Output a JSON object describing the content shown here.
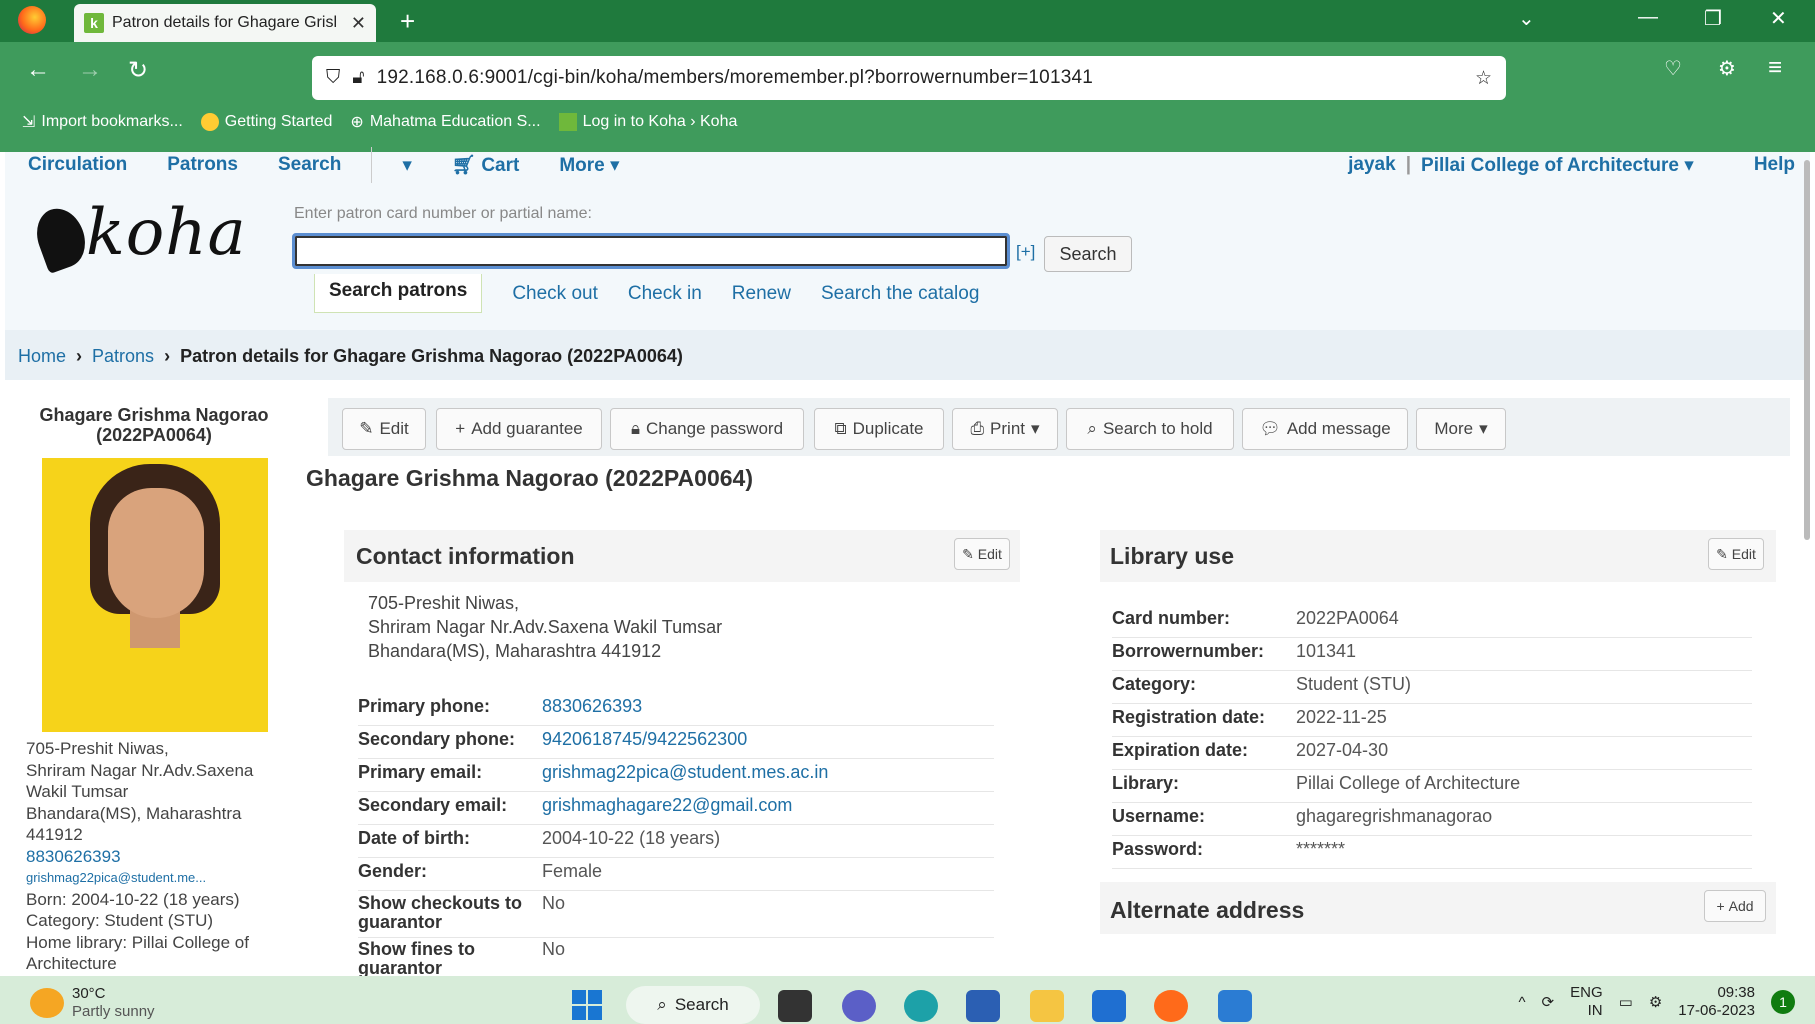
{
  "browser": {
    "tab_title": "Patron details for Ghagare Grisl",
    "url": "192.168.0.6:9001/cgi-bin/koha/members/moremember.pl?borrowernumber=101341",
    "bookmarks": [
      "Import bookmarks...",
      "Getting Started",
      "Mahatma Education S...",
      "Log in to Koha › Koha"
    ]
  },
  "koha_nav": {
    "items": [
      "Circulation",
      "Patrons",
      "Search",
      "Cart",
      "More"
    ],
    "user": "jayak",
    "library": "Pillai College of Architecture",
    "help": "Help"
  },
  "logo_text": "koha",
  "patron_search": {
    "label": "Enter patron card number or partial name:",
    "value": "",
    "plus": "[+]",
    "button": "Search"
  },
  "sub_tabs": [
    "Search patrons",
    "Check out",
    "Check in",
    "Renew",
    "Search the catalog"
  ],
  "breadcrumb": {
    "home": "Home",
    "patrons": "Patrons",
    "current": "Patron details for Ghagare Grishma Nagorao (2022PA0064)"
  },
  "sidebar": {
    "name": "Ghagare Grishma Nagorao (2022PA0064)",
    "address": [
      "705-Preshit Niwas,",
      "Shriram Nagar Nr.Adv.Saxena",
      "Wakil Tumsar",
      "Bhandara(MS), Maharashtra",
      "441912"
    ],
    "phone": "8830626393",
    "email": "grishmag22pica@student.me...",
    "born": "Born: 2004-10-22 (18 years)",
    "category": "Category: Student (STU)",
    "home_library": [
      "Home library: Pillai College of",
      "Architecture"
    ]
  },
  "toolbar": [
    "Edit",
    "Add guarantee",
    "Change password",
    "Duplicate",
    "Print",
    "Search to hold",
    "Add message",
    "More"
  ],
  "patron_title": "Ghagare Grishma Nagorao (2022PA0064)",
  "contact": {
    "title": "Contact information",
    "edit": "Edit",
    "address": [
      "705-Preshit Niwas,",
      "Shriram Nagar Nr.Adv.Saxena Wakil Tumsar",
      "Bhandara(MS), Maharashtra 441912"
    ],
    "rows": [
      {
        "label": "Primary phone:",
        "value": "8830626393"
      },
      {
        "label": "Secondary phone:",
        "value": "9420618745/9422562300"
      },
      {
        "label": "Primary email:",
        "value": "grishmag22pica@student.mes.ac.in"
      },
      {
        "label": "Secondary email:",
        "value": "grishmaghagare22@gmail.com"
      },
      {
        "label": "Date of birth:",
        "value": "2004-10-22 (18 years)"
      },
      {
        "label": "Gender:",
        "value": "Female"
      },
      {
        "label": "Show checkouts to guarantor",
        "value": "No"
      },
      {
        "label": "Show fines to guarantor",
        "value": "No"
      }
    ]
  },
  "library_use": {
    "title": "Library use",
    "edit": "Edit",
    "rows": [
      {
        "label": "Card number:",
        "value": "2022PA0064"
      },
      {
        "label": "Borrowernumber:",
        "value": "101341"
      },
      {
        "label": "Category:",
        "value": "Student (STU)"
      },
      {
        "label": "Registration date:",
        "value": "2022-11-25"
      },
      {
        "label": "Expiration date:",
        "value": "2027-04-30"
      },
      {
        "label": "Library:",
        "value": "Pillai College of Architecture"
      },
      {
        "label": "Username:",
        "value": "ghagaregrishmanagorao"
      },
      {
        "label": "Password:",
        "value": "*******"
      }
    ]
  },
  "alternate_address": {
    "title": "Alternate address",
    "add": "Add"
  },
  "taskbar": {
    "temp": "30°C",
    "weather": "Partly sunny",
    "search": "Search",
    "lang": "ENG",
    "region": "IN",
    "time": "09:38",
    "date": "17-06-2023",
    "notifications": "1"
  }
}
